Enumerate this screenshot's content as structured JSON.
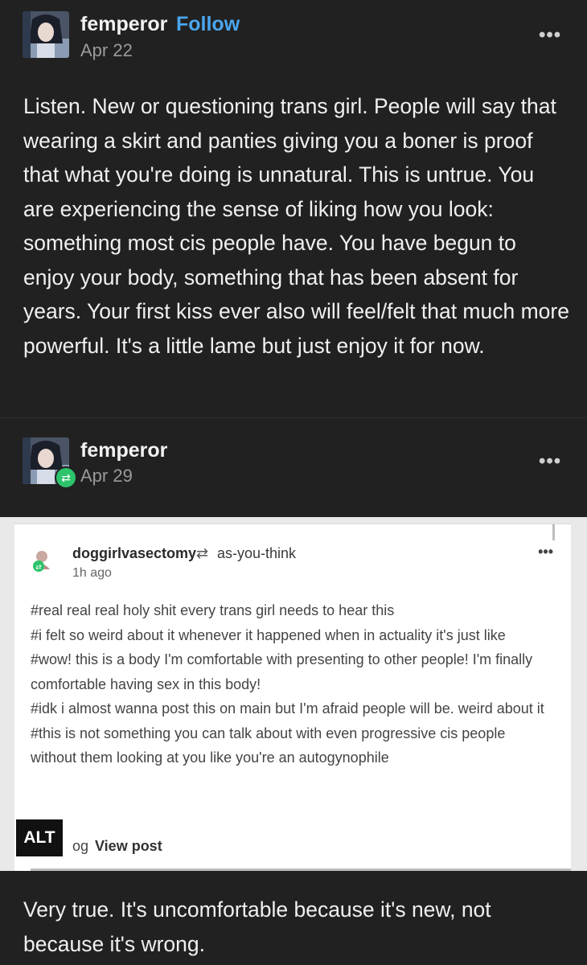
{
  "post1": {
    "username": "femperor",
    "follow": "Follow",
    "date": "Apr 22",
    "more": "•••",
    "body": "Listen. New or questioning trans girl. People will say that wearing a skirt and panties giving you a boner is proof that what you're doing is unnatural. This is untrue. You are experiencing the sense of liking how you look: something most cis people have. You have begun to enjoy your body, something that has been absent for years. Your first kiss ever also will feel/felt that much more powerful. It's a little lame but just enjoy it for now."
  },
  "post2": {
    "username": "femperor",
    "date": "Apr 29",
    "more": "•••",
    "comment": "Very true. It's uncomfortable because it's new, not because it's wrong."
  },
  "screenshot": {
    "user": "doggirlvasectomy",
    "reblog_of": "as-you-think",
    "time": "1h ago",
    "more": "•••",
    "tags": [
      "#real real real holy shit every trans girl needs to hear this",
      "#i felt so weird about it whenever it happened when in actuality it's just like",
      "#wow! this is a body I'm comfortable with presenting to other people! I'm finally comfortable having sex in this body!",
      "#idk i almost wanna post this on main but I'm afraid people will be. weird about it",
      "#this is not something you can talk about with even progressive cis people without them looking at you like you're an autogynophile"
    ],
    "reblog_label": "og",
    "view_post": "View post",
    "alt": "ALT"
  }
}
